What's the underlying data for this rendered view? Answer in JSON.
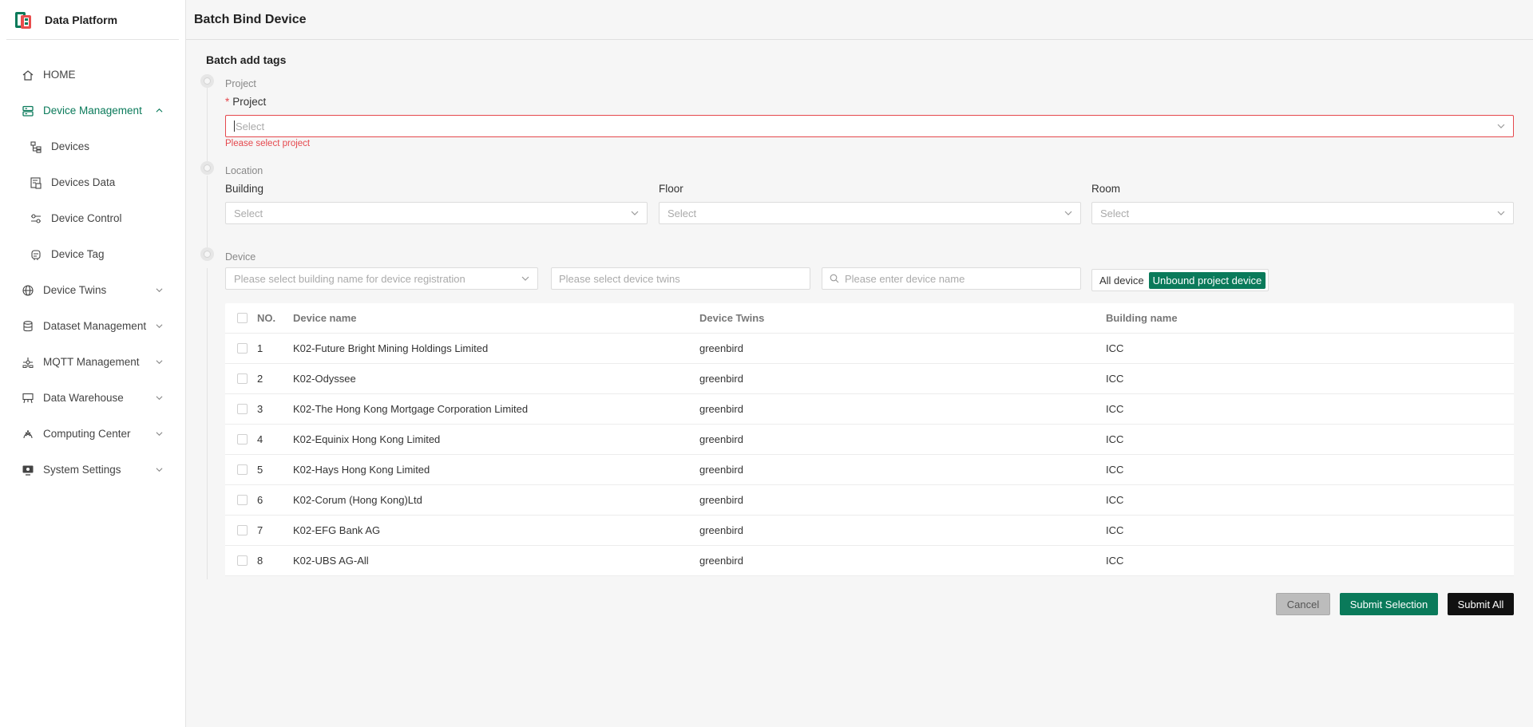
{
  "app": {
    "title": "Data Platform"
  },
  "sidebar": {
    "items": [
      {
        "label": "HOME",
        "icon": "home-icon",
        "level": 0,
        "active": false,
        "chevron": ""
      },
      {
        "label": "Device Management",
        "icon": "server-icon",
        "level": 0,
        "active": true,
        "chevron": "up"
      },
      {
        "label": "Devices",
        "icon": "device-tree-icon",
        "level": 1,
        "active": false,
        "chevron": ""
      },
      {
        "label": "Devices Data",
        "icon": "data-sheet-icon",
        "level": 1,
        "active": false,
        "chevron": ""
      },
      {
        "label": "Device Control",
        "icon": "sliders-icon",
        "level": 1,
        "active": false,
        "chevron": ""
      },
      {
        "label": "Device Tag",
        "icon": "tag-icon",
        "level": 1,
        "active": false,
        "chevron": ""
      },
      {
        "label": "Device Twins",
        "icon": "globe-icon",
        "level": 0,
        "active": false,
        "chevron": "down"
      },
      {
        "label": "Dataset Management",
        "icon": "database-icon",
        "level": 0,
        "active": false,
        "chevron": "down"
      },
      {
        "label": "MQTT Management",
        "icon": "network-icon",
        "level": 0,
        "active": false,
        "chevron": "down"
      },
      {
        "label": "Data Warehouse",
        "icon": "warehouse-icon",
        "level": 0,
        "active": false,
        "chevron": "down"
      },
      {
        "label": "Computing Center",
        "icon": "computing-icon",
        "level": 0,
        "active": false,
        "chevron": "down"
      },
      {
        "label": "System Settings",
        "icon": "monitor-settings-icon",
        "level": 0,
        "active": false,
        "chevron": "down"
      }
    ]
  },
  "header": {
    "title": "Batch Bind Device"
  },
  "form": {
    "section_title": "Batch add tags",
    "steps": {
      "project": "Project",
      "location": "Location",
      "device": "Device"
    },
    "project": {
      "label": "Project",
      "placeholder": "Select",
      "error": "Please select project"
    },
    "building": {
      "label": "Building",
      "placeholder": "Select"
    },
    "floor": {
      "label": "Floor",
      "placeholder": "Select"
    },
    "room": {
      "label": "Room",
      "placeholder": "Select"
    },
    "device_filters": {
      "building_placeholder": "Please select building name for device registration",
      "twins_placeholder": "Please select device twins",
      "name_placeholder": "Please enter device name",
      "toggle_all": "All device",
      "toggle_unbound": "Unbound project device"
    }
  },
  "table": {
    "columns": [
      "NO.",
      "Device name",
      "Device Twins",
      "Building name"
    ],
    "rows": [
      {
        "no": "1",
        "name": "K02-Future Bright Mining Holdings Limited",
        "twins": "greenbird",
        "building": "ICC"
      },
      {
        "no": "2",
        "name": "K02-Odyssee",
        "twins": "greenbird",
        "building": "ICC"
      },
      {
        "no": "3",
        "name": "K02-The Hong Kong Mortgage Corporation Limited",
        "twins": "greenbird",
        "building": "ICC"
      },
      {
        "no": "4",
        "name": "K02-Equinix Hong Kong Limited",
        "twins": "greenbird",
        "building": "ICC"
      },
      {
        "no": "5",
        "name": "K02-Hays Hong Kong Limited",
        "twins": "greenbird",
        "building": "ICC"
      },
      {
        "no": "6",
        "name": "K02-Corum (Hong Kong)Ltd",
        "twins": "greenbird",
        "building": "ICC"
      },
      {
        "no": "7",
        "name": "K02-EFG Bank AG",
        "twins": "greenbird",
        "building": "ICC"
      },
      {
        "no": "8",
        "name": "K02-UBS AG-All",
        "twins": "greenbird",
        "building": "ICC"
      }
    ]
  },
  "actions": {
    "cancel": "Cancel",
    "submit_selection": "Submit Selection",
    "submit_all": "Submit All"
  },
  "colors": {
    "accent": "#0a7a5a",
    "error": "#e5484d"
  }
}
